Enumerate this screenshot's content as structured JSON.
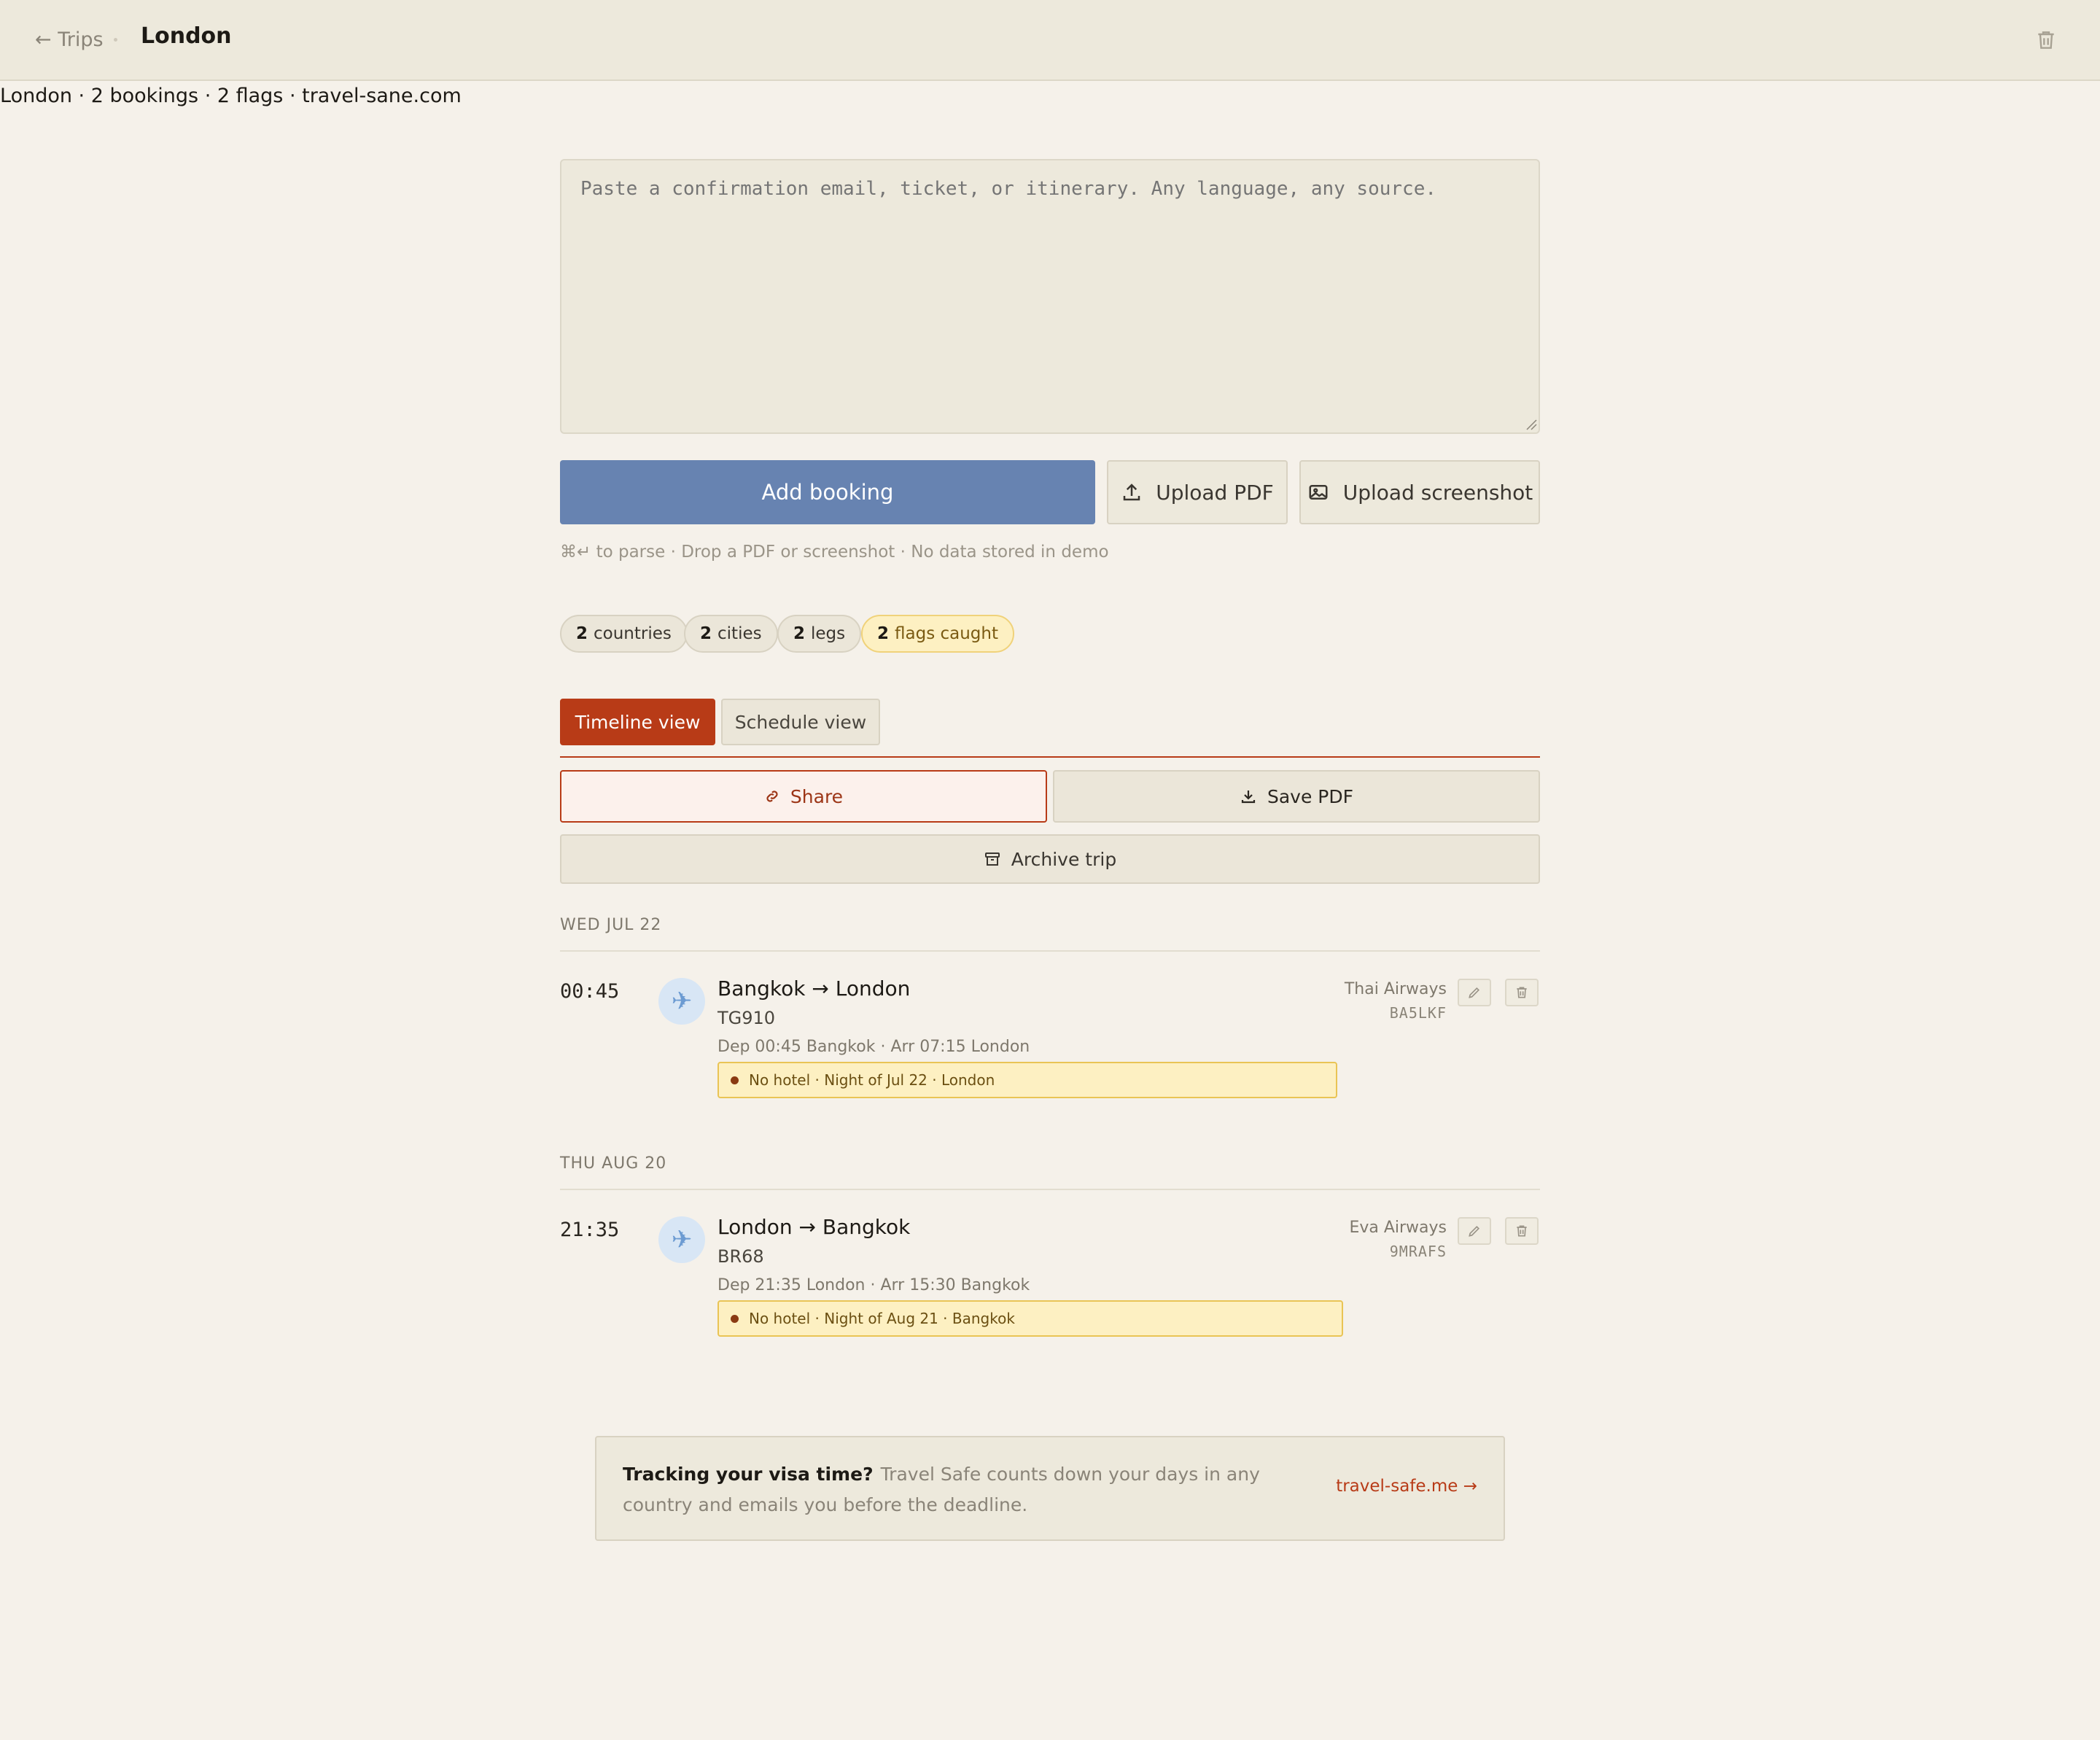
{
  "topbar": {
    "back_label": "← Trips",
    "title": "London"
  },
  "meta_line": "London · 2 bookings · 2 flags · travel-sane.com",
  "paste": {
    "placeholder": "Paste a confirmation email, ticket, or itinerary. Any language, any source."
  },
  "actions": {
    "add_booking": "Add booking",
    "upload_pdf": "Upload PDF",
    "upload_screenshot": "Upload screenshot",
    "hint": "⌘↵ to parse · Drop a PDF or screenshot · No data stored in demo"
  },
  "stats": [
    {
      "count": "2",
      "label": "countries"
    },
    {
      "count": "2",
      "label": "cities"
    },
    {
      "count": "2",
      "label": "legs"
    },
    {
      "count": "2",
      "label": "flags caught"
    }
  ],
  "tabs": {
    "timeline": "Timeline view",
    "schedule": "Schedule view"
  },
  "trip_actions": {
    "share": "Share",
    "save_pdf": "Save PDF",
    "archive": "Archive trip"
  },
  "days": [
    {
      "header": "WED JUL 22",
      "legs": [
        {
          "time": "00:45",
          "title": "Bangkok → London",
          "code": "TG910",
          "detail": "Dep 00:45 Bangkok · Arr 07:15 London",
          "warning": "No hotel · Night of Jul 22 · London",
          "carrier": "Thai Airways",
          "pnr": "BA5LKF"
        }
      ]
    },
    {
      "header": "THU AUG 20",
      "legs": [
        {
          "time": "21:35",
          "title": "London → Bangkok",
          "code": "BR68",
          "detail": "Dep 21:35 London · Arr 15:30 Bangkok",
          "warning": "No hotel · Night of Aug 21 · Bangkok",
          "carrier": "Eva Airways",
          "pnr": "9MRAFS"
        }
      ]
    }
  ],
  "promo": {
    "heading": "Tracking your visa time?",
    "body": "Travel Safe counts down your days in any country and emails you before the deadline.",
    "link": "travel-safe.me →"
  },
  "colors": {
    "accent": "#b83b17",
    "primary_button": "#6783b1",
    "background": "#f5f1ea",
    "warning_bg": "#fdf0c2"
  }
}
